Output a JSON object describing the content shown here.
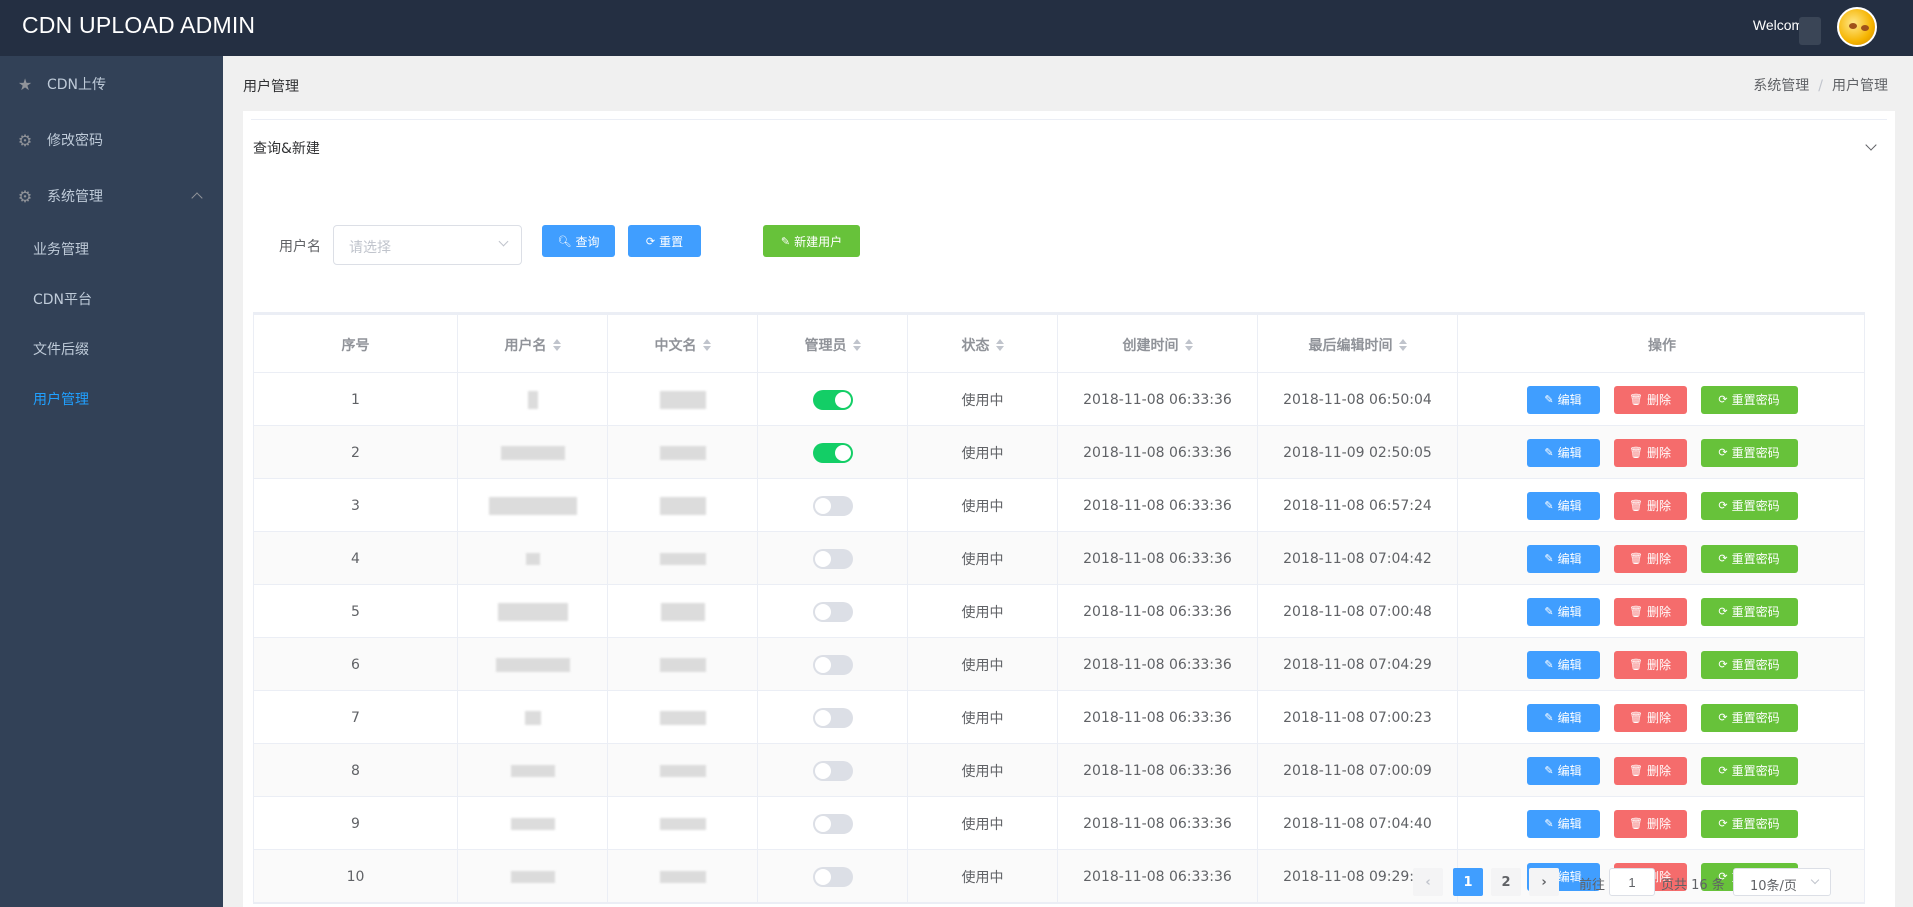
{
  "app": {
    "title": "CDN UPLOAD ADMIN",
    "welcome": "Welcome"
  },
  "sidebar": {
    "items": [
      {
        "label": "CDN上传",
        "icon": "star-icon"
      },
      {
        "label": "修改密码",
        "icon": "gear-icon"
      },
      {
        "label": "系统管理",
        "icon": "gear-icon",
        "expanded": true
      }
    ],
    "sub_items": [
      {
        "label": "业务管理"
      },
      {
        "label": "CDN平台"
      },
      {
        "label": "文件后缀"
      },
      {
        "label": "用户管理",
        "active": true
      }
    ]
  },
  "page": {
    "title": "用户管理",
    "breadcrumb": [
      "系统管理",
      "用户管理"
    ]
  },
  "query": {
    "section_title": "查询&新建",
    "username_label": "用户名",
    "username_placeholder": "请选择",
    "search_label": "查询",
    "reset_label": "重置",
    "new_user_label": "新建用户"
  },
  "table": {
    "columns": [
      "序号",
      "用户名",
      "中文名",
      "管理员",
      "状态",
      "创建时间",
      "最后编辑时间",
      "操作"
    ],
    "rows": [
      {
        "index": "1",
        "admin": true,
        "status": "使用中",
        "created": "2018-11-08 06:33:36",
        "edited": "2018-11-08 06:50:04"
      },
      {
        "index": "2",
        "admin": true,
        "status": "使用中",
        "created": "2018-11-08 06:33:36",
        "edited": "2018-11-09 02:50:05"
      },
      {
        "index": "3",
        "admin": false,
        "status": "使用中",
        "created": "2018-11-08 06:33:36",
        "edited": "2018-11-08 06:57:24"
      },
      {
        "index": "4",
        "admin": false,
        "status": "使用中",
        "created": "2018-11-08 06:33:36",
        "edited": "2018-11-08 07:04:42"
      },
      {
        "index": "5",
        "admin": false,
        "status": "使用中",
        "created": "2018-11-08 06:33:36",
        "edited": "2018-11-08 07:00:48"
      },
      {
        "index": "6",
        "admin": false,
        "status": "使用中",
        "created": "2018-11-08 06:33:36",
        "edited": "2018-11-08 07:04:29"
      },
      {
        "index": "7",
        "admin": false,
        "status": "使用中",
        "created": "2018-11-08 06:33:36",
        "edited": "2018-11-08 07:00:23"
      },
      {
        "index": "8",
        "admin": false,
        "status": "使用中",
        "created": "2018-11-08 06:33:36",
        "edited": "2018-11-08 07:00:09"
      },
      {
        "index": "9",
        "admin": false,
        "status": "使用中",
        "created": "2018-11-08 06:33:36",
        "edited": "2018-11-08 07:04:40"
      },
      {
        "index": "10",
        "admin": false,
        "status": "使用中",
        "created": "2018-11-08 06:33:36",
        "edited": "2018-11-08 09:29:47"
      }
    ],
    "actions": {
      "edit": "编辑",
      "delete": "删除",
      "reset_password": "重置密码"
    }
  },
  "pagination": {
    "pages": [
      "1",
      "2"
    ],
    "current_page": "1",
    "goto_prefix": "前往",
    "goto_value": "1",
    "total_text": "页共 16 条",
    "page_size": "10条/页"
  }
}
